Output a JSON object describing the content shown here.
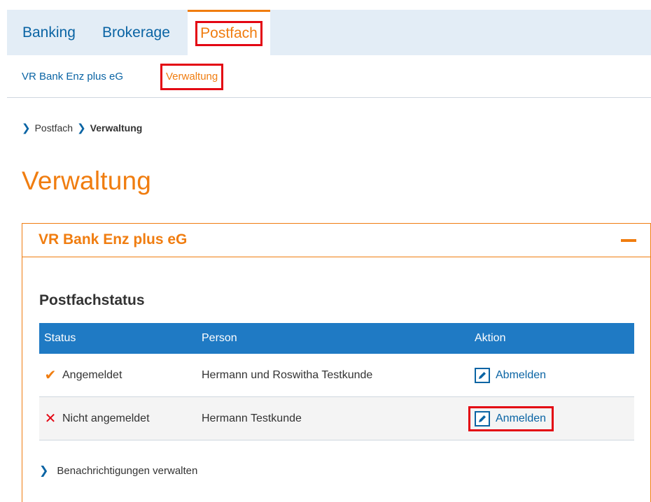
{
  "top_nav": {
    "items": [
      {
        "label": "Banking"
      },
      {
        "label": "Brokerage"
      },
      {
        "label": "Postfach"
      }
    ]
  },
  "sub_nav": {
    "items": [
      {
        "label": "VR Bank Enz plus eG"
      },
      {
        "label": "Verwaltung"
      }
    ]
  },
  "breadcrumb": {
    "items": [
      "Postfach",
      "Verwaltung"
    ]
  },
  "page": {
    "title": "Verwaltung"
  },
  "panel": {
    "title": "VR Bank Enz plus eG",
    "section_title": "Postfachstatus",
    "table": {
      "headers": [
        "Status",
        "Person",
        "Aktion"
      ],
      "rows": [
        {
          "status": "Angemeldet",
          "person": "Hermann und Roswitha Testkunde",
          "action": "Abmelden"
        },
        {
          "status": "Nicht angemeldet",
          "person": "Hermann Testkunde",
          "action": "Anmelden"
        }
      ]
    },
    "notify_link": "Benachrichtigungen verwalten"
  },
  "colors": {
    "accent_orange": "#f07d10",
    "link_blue": "#0a64a4",
    "table_header_blue": "#1f7ac4",
    "highlight_red": "#e30613",
    "topbar_bg": "#e3edf6"
  },
  "icons": {
    "status_ok": "check-icon",
    "status_fail": "cross-icon",
    "action": "pencil-icon",
    "collapse": "minus-icon",
    "chevron": "chevron-right-icon"
  }
}
